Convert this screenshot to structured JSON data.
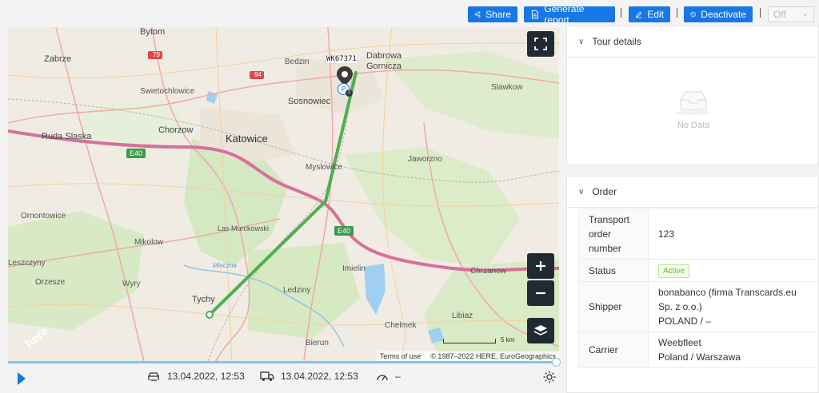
{
  "toolbar": {
    "share": "Share",
    "generate_report": "Generate report",
    "edit": "Edit",
    "deactivate": "Deactivate",
    "status_select": "Off",
    "accent": "#1677e5"
  },
  "map": {
    "labels": {
      "bytom": "Bytom",
      "zabrze": "Zabrze",
      "swietochlowice": "Swietochlowice",
      "bedzin": "Bedzin",
      "dabrowa": "Dabrowa",
      "gornicza": "Gornicza",
      "slawkow": "Slawkow",
      "sosnowiec": "Sosnowiec",
      "ruda": "Ruda Slaska",
      "chorzow": "Chorzow",
      "katowice": "Katowice",
      "myslowice": "Myslowice",
      "jaworzno": "Jaworzno",
      "ornontowice": "Ornontowice",
      "mikolow": "Mikolow",
      "las": "Las Murckowski",
      "leszczyny": "Leszczyny",
      "orzesze": "Orzesze",
      "wyry": "Wyry",
      "imielin": "Imielin",
      "chrzanow": "Chrzanow",
      "ledziny": "Ledziny",
      "tychy": "Tychy",
      "libiaz": "Libiaz",
      "chelmek": "Chelmek",
      "bierun": "Bierun",
      "mleczna": "Mleczna",
      "vehicle": "WK67371",
      "r79": "79",
      "r94": "94",
      "e40a": "E40",
      "e40b": "E40",
      "here": "here"
    },
    "parking_badge": "P",
    "parking_count": "1",
    "scale_label": "5 km",
    "terms": "Terms of use",
    "copyright": "© 1987–2022 HERE, EuroGeographics",
    "route_color": "#4caf50"
  },
  "timeline": {
    "start": "13.04.2022, 12:53",
    "end": "13.04.2022, 12:53",
    "speed": "–"
  },
  "tour": {
    "title": "Tour details",
    "empty": "No Data"
  },
  "order": {
    "title": "Order",
    "rows": [
      {
        "key": "Transport order number",
        "value": "123"
      },
      {
        "key": "Status",
        "value": "Active"
      },
      {
        "key": "Shipper",
        "value": "bonabanco (firma Transcards.eu Sp. z o.o.)",
        "value2": "POLAND / –"
      },
      {
        "key": "Carrier",
        "value": "Weebfleet",
        "value2": "Poland / Warszawa"
      }
    ]
  }
}
